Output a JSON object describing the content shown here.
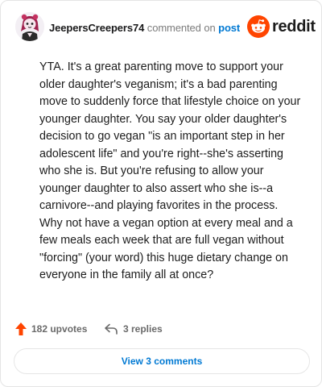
{
  "comment": {
    "username": "JeepersCreepers74",
    "action_text": "commented on",
    "post_link": "post",
    "body": "YTA. It's a great parenting move to support your older daughter's veganism; it's a bad parenting move to suddenly force that lifestyle choice on your younger daughter. You say your older daughter's decision to go vegan \"is an important step in her adolescent life\" and you're right--she's asserting who she is. But you're refusing to allow your younger daughter to also assert who she is--a carnivore--and playing favorites in the process. Why not have a vegan option at every meal and a few meals each week that are full vegan without \"forcing\" (your word) this huge dietary change on everyone in the family all at once?"
  },
  "brand": {
    "name": "reddit",
    "color": "#ff4500"
  },
  "footer": {
    "upvotes_label": "182 upvotes",
    "replies_label": "3 replies",
    "view_comments_label": "View 3 comments"
  },
  "colors": {
    "link": "#0079d3",
    "upvote": "#ff4500",
    "meta": "#7c7c7c"
  },
  "icons": [
    "avatar",
    "reddit-logo-icon",
    "upvote-arrow-icon",
    "reply-icon"
  ]
}
